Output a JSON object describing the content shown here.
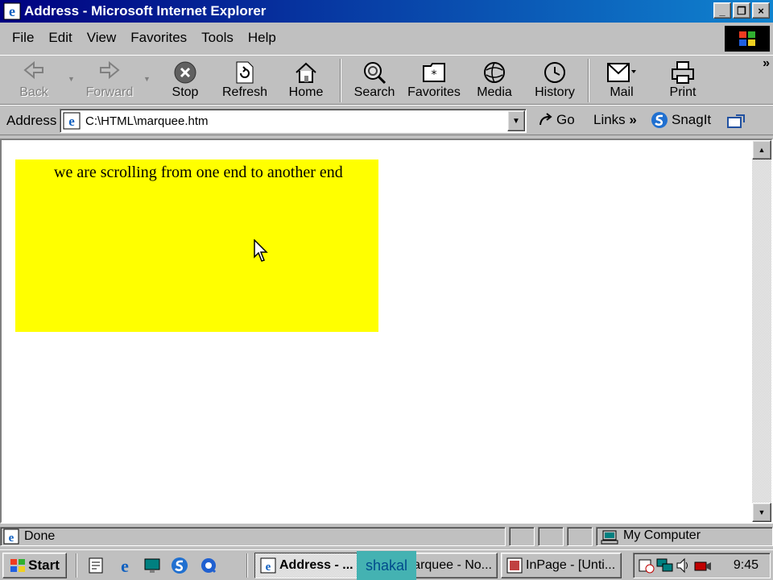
{
  "window": {
    "title": "Address - Microsoft Internet Explorer",
    "min": "_",
    "max": "❐",
    "close": "×"
  },
  "menu": {
    "items": [
      "File",
      "Edit",
      "View",
      "Favorites",
      "Tools",
      "Help"
    ]
  },
  "toolbar": {
    "back": "Back",
    "forward": "Forward",
    "stop": "Stop",
    "refresh": "Refresh",
    "home": "Home",
    "search": "Search",
    "favorites": "Favorites",
    "media": "Media",
    "history": "History",
    "mail": "Mail",
    "print": "Print"
  },
  "address": {
    "label": "Address",
    "url": "C:\\HTML\\marquee.htm",
    "go": "Go",
    "links": "Links",
    "snagit": "SnagIt"
  },
  "page": {
    "marquee_text": "we are scrolling from one end to another end",
    "marquee_color": "#ffff00"
  },
  "status": {
    "text": "Done",
    "zone": "My Computer"
  },
  "taskbar": {
    "start": "Start",
    "tasks": [
      "Address - ...",
      "marquee - No...",
      "InPage - [Unti..."
    ],
    "clock": "9:45"
  },
  "overlay": {
    "label": "shakal"
  }
}
